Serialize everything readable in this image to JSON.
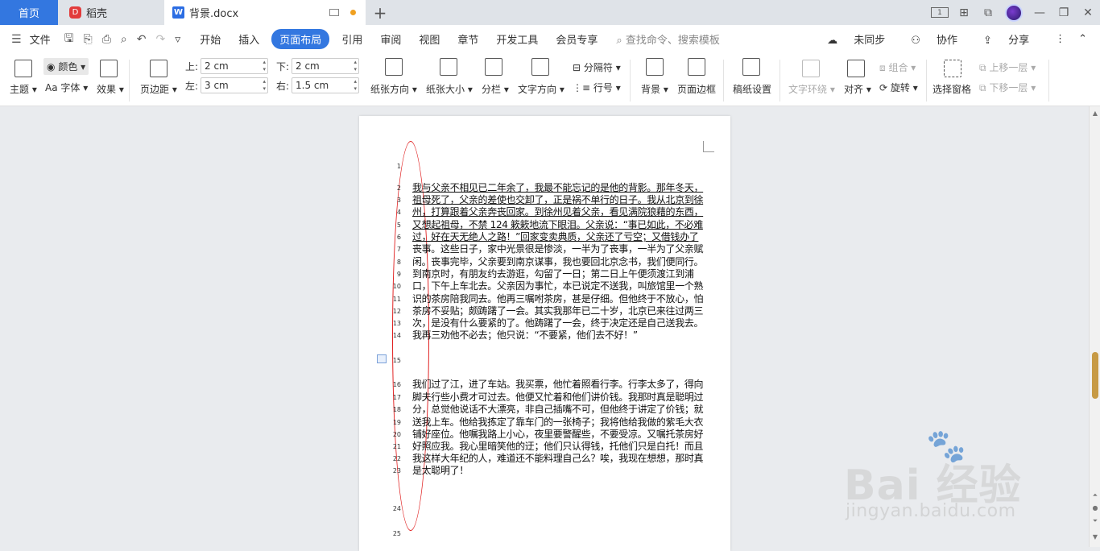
{
  "tabs": {
    "home": "首页",
    "daoke": "稻壳",
    "doc": "背景.docx",
    "add": "+"
  },
  "window": {
    "layout_badge": "1",
    "min": "—",
    "restore": "❐",
    "close": "✕"
  },
  "menu": {
    "file": "文件",
    "items": [
      "开始",
      "插入",
      "页面布局",
      "引用",
      "审阅",
      "视图",
      "章节",
      "开发工具",
      "会员专享"
    ],
    "active": "页面布局",
    "search": "查找命令、搜索模板",
    "unsync": "未同步",
    "collab": "协作",
    "share": "分享"
  },
  "ribbon": {
    "theme": "主题",
    "color": "颜色",
    "font": "字体",
    "effect": "效果",
    "margins": "页边距",
    "top_label": "上:",
    "top_value": "2 cm",
    "bottom_label": "下:",
    "bottom_value": "2 cm",
    "left_label": "左:",
    "left_value": "3 cm",
    "right_label": "右:",
    "right_value": "1.5 cm",
    "orientation": "纸张方向",
    "size": "纸张大小",
    "columns": "分栏",
    "text_direction": "文字方向",
    "separator": "分隔符",
    "line_number": "行号",
    "background": "背景",
    "page_border": "页面边框",
    "manuscript": "稿纸设置",
    "text_wrap": "文字环绕",
    "align": "对齐",
    "group": "组合",
    "rotate": "旋转",
    "selection_pane": "选择窗格",
    "bring_forward": "上移一层",
    "send_backward": "下移一层"
  },
  "document": {
    "lines": [
      {
        "n": "1",
        "t": ""
      },
      {
        "n": "2",
        "t": "我与父亲不相见已二年余了，我最不能忘记的是他的背影。那年冬天，"
      },
      {
        "n": "3",
        "t": "祖母死了，父亲的差使也交卸了，正是祸不单行的日子。我从北京到徐"
      },
      {
        "n": "4",
        "t": "州，打算跟着父亲奔丧回家。到徐州见着父亲，看见满院狼藉的东西，"
      },
      {
        "n": "5",
        "t": "又想起祖母，不禁 124 簌簌地流下眼泪。父亲说：“事已如此，不必难"
      },
      {
        "n": "6",
        "t": "过，好在天无绝人之路！”回家变卖典质，父亲还了亏空；又借钱办了"
      },
      {
        "n": "7",
        "t": "丧事。这些日子，家中光景很是惨淡，一半为了丧事，一半为了父亲赋"
      },
      {
        "n": "8",
        "t": "闲。丧事完毕，父亲要到南京谋事，我也要回北京念书，我们便同行。"
      },
      {
        "n": "9",
        "t": "到南京时，有朋友约去游逛，勾留了一日；第二日上午便须渡江到浦"
      },
      {
        "n": "10",
        "t": "口，下午上车北去。父亲因为事忙，本已说定不送我，叫旅馆里一个熟"
      },
      {
        "n": "11",
        "t": "识的茶房陪我同去。他再三嘱咐茶房，甚是仔细。但他终于不放心，怕"
      },
      {
        "n": "12",
        "t": "茶房不妥贴；颇踌躇了一会。其实我那年已二十岁，北京已来往过两三"
      },
      {
        "n": "13",
        "t": "次，是没有什么要紧的了。他踌躇了一会，终于决定还是自己送我去。"
      },
      {
        "n": "14",
        "t": "我再三劝他不必去；他只说：“不要紧，他们去不好！”"
      },
      {
        "n": "15",
        "t": ""
      },
      {
        "n": "16",
        "t": "我们过了江，进了车站。我买票，他忙着照看行李。行李太多了，得向"
      },
      {
        "n": "17",
        "t": "脚夫行些小费才可过去。他便又忙着和他们讲价钱。我那时真是聪明过"
      },
      {
        "n": "18",
        "t": "分，总觉他说话不大漂亮，非自己插嘴不可，但他终于讲定了价钱；就"
      },
      {
        "n": "19",
        "t": "送我上车。他给我拣定了靠车门的一张椅子；我将他给我做的紫毛大衣"
      },
      {
        "n": "20",
        "t": "铺好座位。他嘱我路上小心，夜里要警醒些，不要受凉。又嘱托茶房好"
      },
      {
        "n": "21",
        "t": "好照应我。我心里暗笑他的迂；他们只认得钱，托他们只是白托！而且"
      },
      {
        "n": "22",
        "t": "我这样大年纪的人，难道还不能料理自己么？唉，我现在想想，那时真"
      },
      {
        "n": "23",
        "t": "是太聪明了！"
      },
      {
        "n": "24",
        "t": ""
      },
      {
        "n": "25",
        "t": ""
      }
    ]
  },
  "watermark": {
    "logo": "Bai 经验",
    "url": "jingyan.baidu.com"
  },
  "colors": {
    "accent": "#3377e0",
    "annotation": "#e02020",
    "scroll_thumb": "#c79a45"
  }
}
